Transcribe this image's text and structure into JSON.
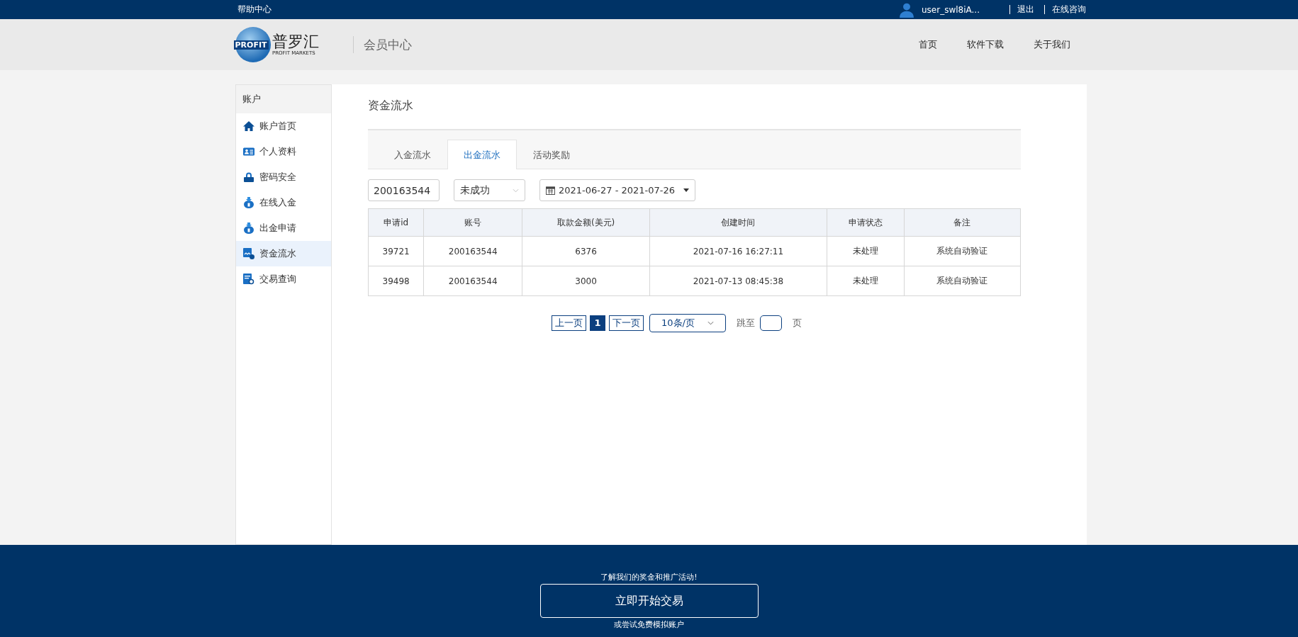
{
  "top_bar": {
    "help": "帮助中心",
    "user": "user_swl8iA...",
    "links": [
      "退出",
      "在线咨询"
    ]
  },
  "header": {
    "logo": {
      "badge": "PROFIT",
      "name": "普罗汇",
      "subtitle": "PROFIT MARKETS"
    },
    "section": "会员中心",
    "nav": [
      "首页",
      "软件下载",
      "关于我们"
    ]
  },
  "sidebar": {
    "heading": "账户",
    "items": [
      {
        "label": "账户首页",
        "selected": false
      },
      {
        "label": "个人资料",
        "selected": false
      },
      {
        "label": "密码安全",
        "selected": false
      },
      {
        "label": "在线入金",
        "selected": false
      },
      {
        "label": "出金申请",
        "selected": false
      },
      {
        "label": "资金流水",
        "selected": true
      },
      {
        "label": "交易查询",
        "selected": false
      }
    ]
  },
  "page_title": "资金流水",
  "tabs": [
    {
      "label": "入金流水",
      "selected": false
    },
    {
      "label": "出金流水",
      "selected": true
    },
    {
      "label": "活动奖励",
      "selected": false
    }
  ],
  "filters": {
    "account": "200163544",
    "status": "未成功",
    "date_range": "2021-06-27 - 2021-07-26"
  },
  "table": {
    "columns": [
      "申请id",
      "账号",
      "取款金额(美元)",
      "创建时间",
      "申请状态",
      "备注"
    ],
    "rows": [
      [
        "39721",
        "200163544",
        "6376",
        "2021-07-16 16:27:11",
        "未处理",
        "系统自动验证"
      ],
      [
        "39498",
        "200163544",
        "3000",
        "2021-07-13 08:45:38",
        "未处理",
        "系统自动验证"
      ]
    ]
  },
  "pagination": {
    "prev": "上一页",
    "pages": [
      {
        "label": "1",
        "selected": true
      }
    ],
    "next": "下一页",
    "page_size": "10条/页",
    "jump_label": "跳至",
    "jump_suffix": "页"
  },
  "footer": {
    "promo": "了解我们的奖金和推广活动!",
    "cta": "立即开始交易",
    "demo": "或尝试免费模拟账户"
  }
}
